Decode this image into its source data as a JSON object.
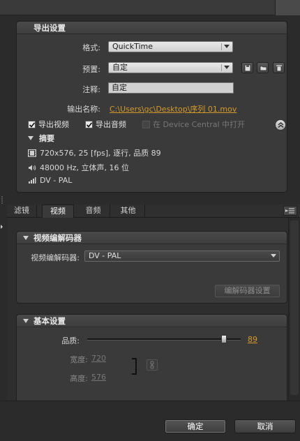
{
  "export_settings": {
    "title": "导出设置",
    "format_label": "格式:",
    "format_value": "QuickTime",
    "preset_label": "预置:",
    "preset_value": "自定",
    "comment_label": "注释:",
    "comment_value": "自定",
    "output_label": "输出名称:",
    "output_value": "C:\\Users\\gc\\Desktop\\序列 01.mov",
    "export_video_label": "导出视频",
    "export_video_checked": true,
    "export_audio_label": "导出音频",
    "export_audio_checked": true,
    "device_central_label": "在 Device Central 中打开",
    "device_central_checked": false,
    "icons": [
      "save-preset-icon",
      "import-preset-icon",
      "delete-preset-icon",
      "collapse-up-icon"
    ]
  },
  "summary": {
    "title": "摘要",
    "video_line": "720x576, 25 [fps], 逐行, 品质 89",
    "audio_line": "48000 Hz, 立体声, 16 位",
    "codec_line": "DV - PAL",
    "icons": [
      "film-strip-icon",
      "speaker-icon",
      "bitrate-icon"
    ]
  },
  "tabs": {
    "items": [
      "滤镜",
      "视频",
      "音频",
      "其他"
    ],
    "active": "视频"
  },
  "video_codec": {
    "title": "视频编解码器",
    "codec_label": "视频编解码器:",
    "codec_value": "DV - PAL",
    "settings_button": "编解码器设置"
  },
  "basic_settings": {
    "title": "基本设置",
    "quality_label": "品质:",
    "quality_value": 89,
    "quality_text": "89",
    "width_label": "宽度:",
    "width_value": "720",
    "height_label": "高度:",
    "height_value": "576"
  },
  "footer": {
    "ok_label": "确定",
    "cancel_label": "取消"
  },
  "colors": {
    "accent_link": "#d49a2a",
    "panel_bg": "#3a3a3a",
    "window_bg": "#2b2b2b"
  }
}
